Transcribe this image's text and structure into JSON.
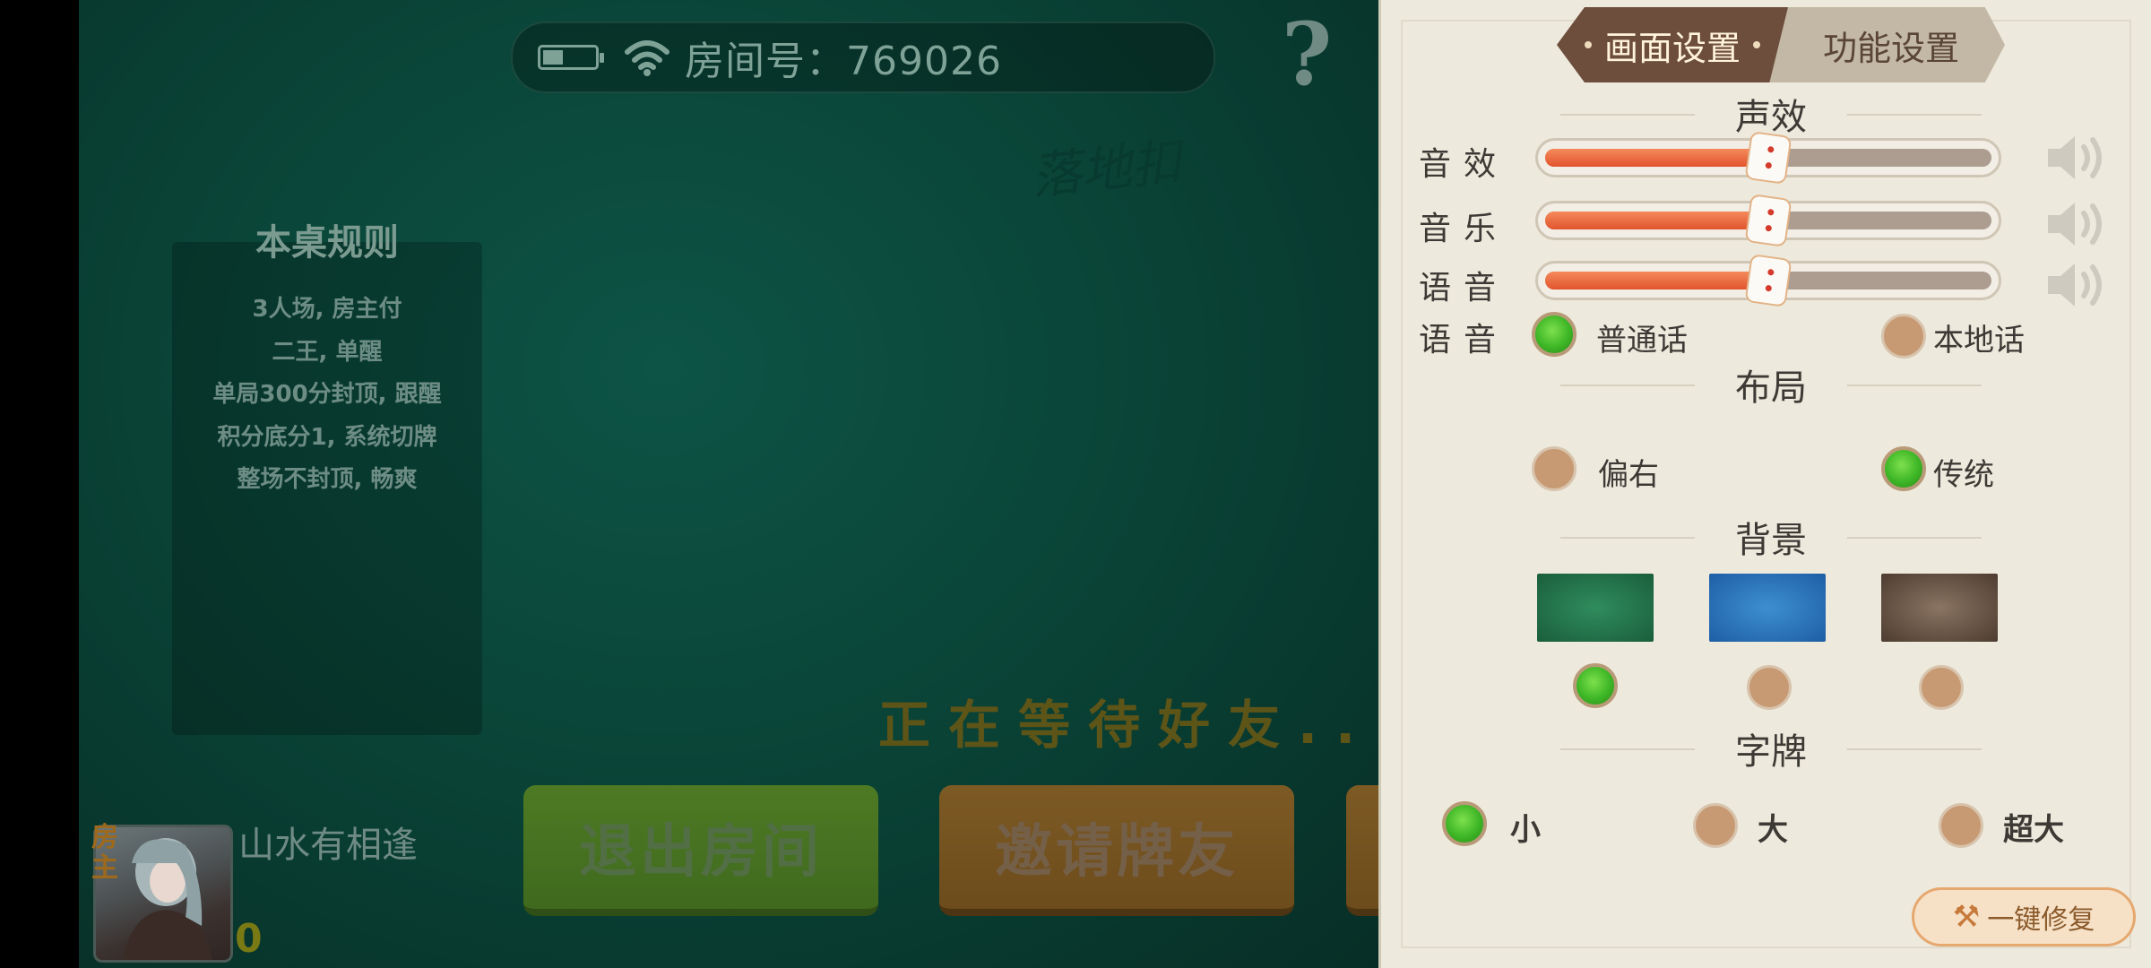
{
  "topbar": {
    "room_label": "房间号：769026"
  },
  "help_symbol": "?",
  "watermark": "落地扣",
  "rules": {
    "title": "本桌规则",
    "items": [
      "3人场, 房主付",
      "二王, 单醒",
      "单局300分封顶, 跟醒",
      "积分底分1, 系统切牌",
      "整场不封顶, 畅爽"
    ]
  },
  "waiting_text": "正在等待好友...",
  "buttons": {
    "exit": "退出房间",
    "invite": "邀请牌友"
  },
  "player": {
    "badge": "房主",
    "name": "山水有相逢",
    "score": "0"
  },
  "settings": {
    "tabs": {
      "display": "画面设置",
      "function": "功能设置"
    },
    "sound_section": "声效",
    "sliders": [
      {
        "label": "音效",
        "level": 0.5
      },
      {
        "label": "音乐",
        "level": 0.5
      },
      {
        "label": "语音",
        "level": 0.5
      }
    ],
    "voice": {
      "label": "语音",
      "options": [
        "普通话",
        "本地话"
      ],
      "selected": 0
    },
    "layout": {
      "title": "布局",
      "options": [
        "偏右",
        "传统"
      ],
      "selected": 1
    },
    "background": {
      "title": "背景",
      "options": [
        "green",
        "blue",
        "brown"
      ],
      "selected": 0,
      "colors": [
        "#1f6e47",
        "#2a72b8",
        "#6f5a48"
      ]
    },
    "cards": {
      "title": "字牌",
      "options": [
        "小",
        "大",
        "超大"
      ],
      "selected": 0
    },
    "repair": "一键修复"
  }
}
